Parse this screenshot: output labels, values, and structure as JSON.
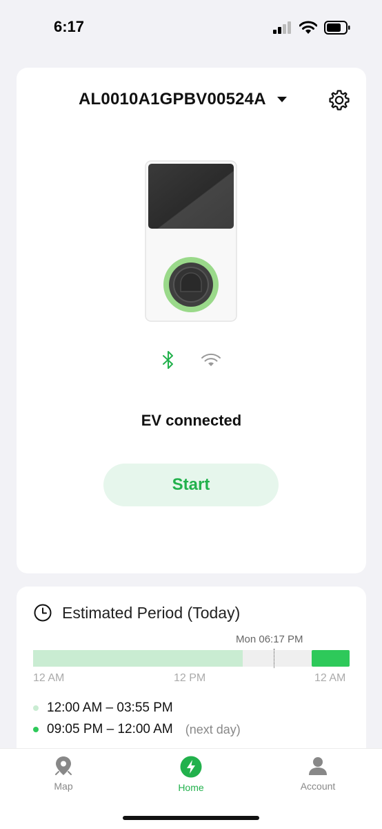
{
  "status_bar": {
    "time": "6:17"
  },
  "device": {
    "id": "AL0010A1GPBV00524A"
  },
  "charger": {
    "status": "EV connected",
    "start_label": "Start"
  },
  "period": {
    "title": "Estimated Period (Today)",
    "current_time": "Mon 06:17 PM",
    "ticks": [
      "12 AM",
      "12 PM",
      "12 AM"
    ],
    "ranges": [
      {
        "text": "12:00 AM – 03:55 PM",
        "note": "",
        "color": "#c9ecd2"
      },
      {
        "text": "09:05 PM – 12:00 AM",
        "note": "(next day)",
        "color": "#2ec95a"
      }
    ]
  },
  "tabs": [
    {
      "label": "Map",
      "icon": "map-pin-icon"
    },
    {
      "label": "Home",
      "icon": "lightning-icon"
    },
    {
      "label": "Account",
      "icon": "person-icon"
    }
  ],
  "colors": {
    "accent": "#22b14c",
    "accent_light": "#e6f6ec",
    "bluetooth": "#22b14c",
    "wifi_inactive": "#999999"
  }
}
